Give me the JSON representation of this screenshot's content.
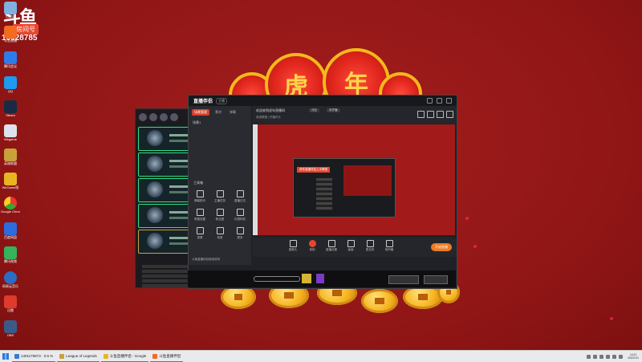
{
  "desktop": {
    "logo_mark": "斗鱼",
    "room_tag": "房间号",
    "room_number": "10028785",
    "icons": [
      {
        "label": "回收站",
        "color": "#7fb0e0"
      },
      {
        "label": "斗鱼直播",
        "color": "#f36b21"
      },
      {
        "label": "腾讯会议",
        "color": "#2f7ce8"
      },
      {
        "label": "QQ",
        "color": "#1d9bf0"
      },
      {
        "label": "Steam",
        "color": "#1a2a44"
      },
      {
        "label": "Steam平台",
        "color": "#223a5e"
      },
      {
        "label": "Wegame",
        "color": "#dde3ea"
      },
      {
        "label": "英雄联盟",
        "color": "#c8a13a"
      },
      {
        "label": "WeGame版",
        "color": "#e8b520"
      },
      {
        "label": "Google Chrome",
        "color": "#e8b520"
      },
      {
        "label": "百度网盘",
        "color": "#2d6bde"
      },
      {
        "label": "腾讯视频",
        "color": "#35b35a"
      },
      {
        "label": "网易云音乐",
        "color": "#2b6cc4"
      },
      {
        "label": "迅雷",
        "color": "#e03a2e"
      },
      {
        "label": "OBS",
        "color": "#3a5b8a"
      }
    ]
  },
  "decor": {
    "characters": [
      "虎",
      "年"
    ]
  },
  "app": {
    "brand": "直播伴侣",
    "brand_badge": "主播",
    "panel_tabs": [
      "场景管理",
      "素材",
      "弹幕"
    ],
    "scene_label": "场景1",
    "tools_title": "工具箱",
    "tools": [
      {
        "label": "弹幕助手"
      },
      {
        "label": "主播任务"
      },
      {
        "label": "直播日志"
      },
      {
        "label": "房管设置"
      },
      {
        "label": "粉丝团"
      },
      {
        "label": "礼物特效"
      },
      {
        "label": "录屏"
      },
      {
        "label": "录音"
      },
      {
        "label": "更多"
      }
    ],
    "panel_footer": "斗鱼直播伴侣使用说明",
    "stream_title": "欢迎来到虎年直播间",
    "stream_meta": "英雄联盟 | 开播时长",
    "pills": [
      "分区",
      "未开播"
    ],
    "controls": [
      {
        "label": "摄像头"
      },
      {
        "label": "录制"
      },
      {
        "label": "直播设置"
      },
      {
        "label": "画面"
      },
      {
        "label": "麦克风"
      },
      {
        "label": "扬声器"
      }
    ],
    "golive_label": "开始直播",
    "nested_highlight": "虎年直播伴侣上手教程"
  },
  "taskbar": {
    "items": [
      {
        "label": "1401176873 · 0.6 %",
        "color": "#3a7bd5"
      },
      {
        "label": "League of Legends",
        "color": "#c8a13a"
      },
      {
        "label": "斗鱼直播伴侣 - Google",
        "color": "#e8b520"
      },
      {
        "label": "斗鱼直播伴侣",
        "color": "#f36b21"
      }
    ],
    "time": "14:11",
    "date": "2022/1/1"
  }
}
